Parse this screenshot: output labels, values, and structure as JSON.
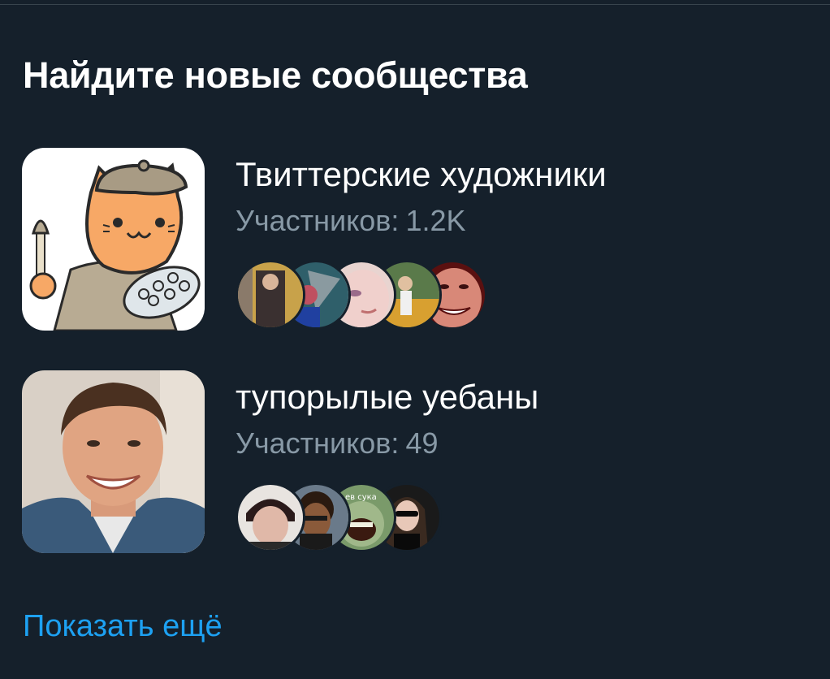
{
  "section": {
    "title": "Найдите новые сообщества"
  },
  "communities": [
    {
      "name": "Твиттерские художники",
      "members_label": "Участников:",
      "members_count": "1.2K",
      "avatar_icon": "cat-painter-avatar",
      "facepile_count": 5
    },
    {
      "name": "тупорылые уебаны",
      "members_label": "Участников:",
      "members_count": "49",
      "avatar_icon": "smiling-man-photo",
      "facepile_count": 4
    }
  ],
  "facepile_texts": {
    "sticker": "ев сука"
  },
  "footer": {
    "show_more": "Показать ещё"
  },
  "colors": {
    "background": "#15202b",
    "primary_text": "#ffffff",
    "secondary_text": "#8899a6",
    "link": "#1da1f2",
    "divider": "#38444d"
  }
}
